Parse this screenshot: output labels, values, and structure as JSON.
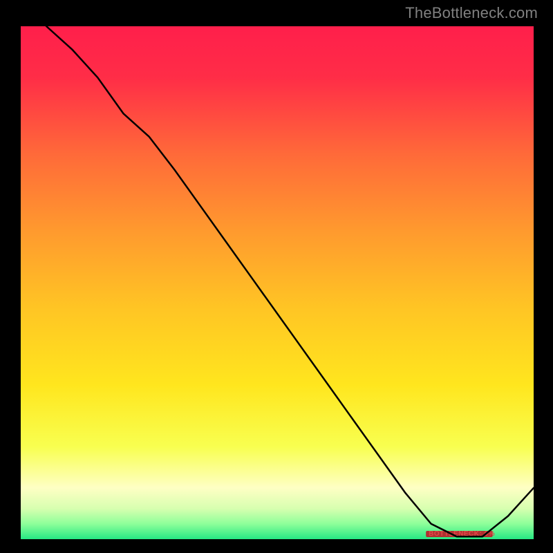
{
  "watermark": "TheBottleneck.com",
  "annotation": "BOTTLENECK: 0%",
  "chart_data": {
    "type": "line",
    "title": "",
    "xlabel": "",
    "ylabel": "",
    "xlim": [
      0,
      100
    ],
    "ylim": [
      0,
      100
    ],
    "grid": false,
    "series": [
      {
        "name": "bottleneck-curve",
        "x": [
          5,
          10,
          15,
          20,
          25,
          30,
          35,
          40,
          45,
          50,
          55,
          60,
          65,
          70,
          75,
          80,
          85,
          90,
          95,
          100
        ],
        "values": [
          100,
          95.5,
          90,
          83,
          78.5,
          72,
          65,
          58,
          51,
          44,
          37,
          30,
          23,
          16,
          9,
          3,
          0.5,
          0.5,
          4.5,
          10
        ]
      }
    ],
    "optimal_zone": {
      "x_start": 79,
      "x_end": 92
    },
    "gradient_stops": [
      {
        "offset": 0.0,
        "color": "#ff1f4b"
      },
      {
        "offset": 0.1,
        "color": "#ff2d47"
      },
      {
        "offset": 0.25,
        "color": "#ff6a39"
      },
      {
        "offset": 0.4,
        "color": "#ff9a2e"
      },
      {
        "offset": 0.55,
        "color": "#ffc524"
      },
      {
        "offset": 0.7,
        "color": "#ffe61e"
      },
      {
        "offset": 0.82,
        "color": "#f8ff50"
      },
      {
        "offset": 0.9,
        "color": "#feffc4"
      },
      {
        "offset": 0.94,
        "color": "#d8ffb0"
      },
      {
        "offset": 0.97,
        "color": "#8eff9a"
      },
      {
        "offset": 1.0,
        "color": "#26e884"
      }
    ]
  }
}
